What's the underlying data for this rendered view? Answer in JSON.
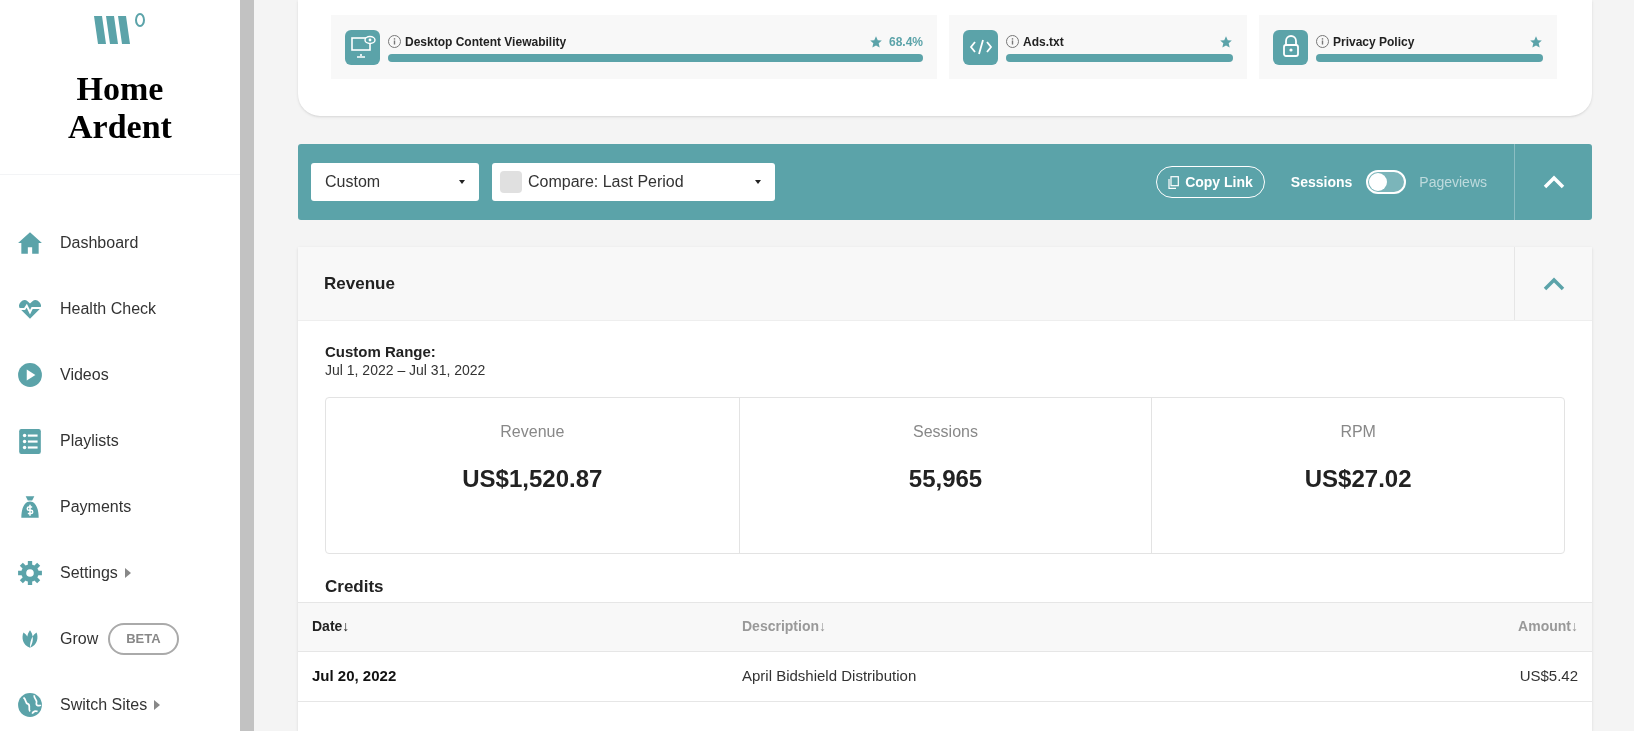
{
  "sidebar": {
    "brand": "Home Ardent",
    "items": [
      {
        "label": "Dashboard",
        "submenu": false
      },
      {
        "label": "Health Check",
        "submenu": false
      },
      {
        "label": "Videos",
        "submenu": false
      },
      {
        "label": "Playlists",
        "submenu": false
      },
      {
        "label": "Payments",
        "submenu": false
      },
      {
        "label": "Settings",
        "submenu": true
      },
      {
        "label": "Grow",
        "badge": "BETA",
        "submenu": false
      },
      {
        "label": "Switch Sites",
        "submenu": true
      }
    ]
  },
  "health": [
    {
      "label": "Desktop Content Viewability",
      "value": "68.4%",
      "level": 1
    },
    {
      "label": "Ads.txt",
      "level": 1
    },
    {
      "label": "Privacy Policy",
      "level": 1
    }
  ],
  "toolbar": {
    "range": "Custom",
    "compare": {
      "label": "Compare: Last Period",
      "checked": false
    },
    "copy_link": "Copy Link",
    "toggle": {
      "left": "Sessions",
      "right": "Pageviews",
      "on": false
    },
    "expanded": true
  },
  "revenue": {
    "title": "Revenue",
    "expanded": true,
    "range_label": "Custom Range:",
    "range": "Jul 1, 2022 – Jul 31, 2022",
    "stats": [
      {
        "label": "Revenue",
        "value": "US$1,520.87"
      },
      {
        "label": "Sessions",
        "value": "55,965"
      },
      {
        "label": "RPM",
        "value": "US$27.02"
      }
    ],
    "credits_title": "Credits",
    "columns": [
      {
        "label": "Date↓",
        "selected": true
      },
      {
        "label": "Description↓",
        "selected": false
      },
      {
        "label": "Amount↓",
        "selected": false
      }
    ],
    "rows": [
      [
        "Jul 20, 2022",
        "April Bidshield Distribution",
        "US$5.42"
      ]
    ]
  }
}
